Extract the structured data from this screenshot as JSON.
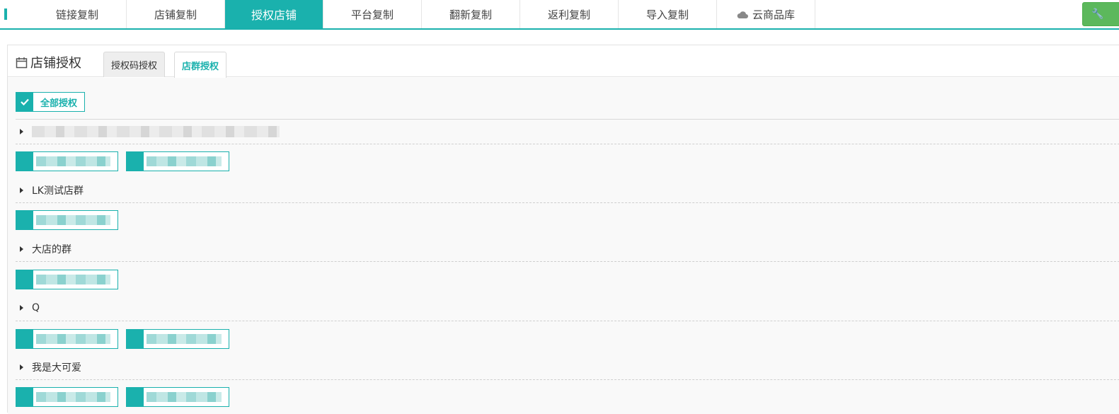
{
  "topnav": {
    "tabs": [
      "链接复制",
      "店铺复制",
      "授权店铺",
      "平台复制",
      "翻新复制",
      "返利复制",
      "导入复制",
      "云商品库"
    ],
    "active_tab": "授权店铺",
    "tool_button_glyph": "🔧"
  },
  "panel": {
    "title": "店铺授权",
    "tabs": [
      "授权码授权",
      "店群授权"
    ],
    "active_tab": "店群授权",
    "select_all_label": "全部授权",
    "groups": [
      {
        "name": "",
        "redacted": true,
        "shops": 2
      },
      {
        "name": "LK测试店群",
        "redacted": false,
        "shops": 1
      },
      {
        "name": "大店的群",
        "redacted": false,
        "shops": 1
      },
      {
        "name": "Q",
        "redacted": false,
        "shops": 2
      },
      {
        "name": "我是大可爱",
        "redacted": false,
        "shops": 2
      }
    ]
  },
  "colors": {
    "accent": "#1ab1ad",
    "tool_button": "#5cb85c"
  }
}
